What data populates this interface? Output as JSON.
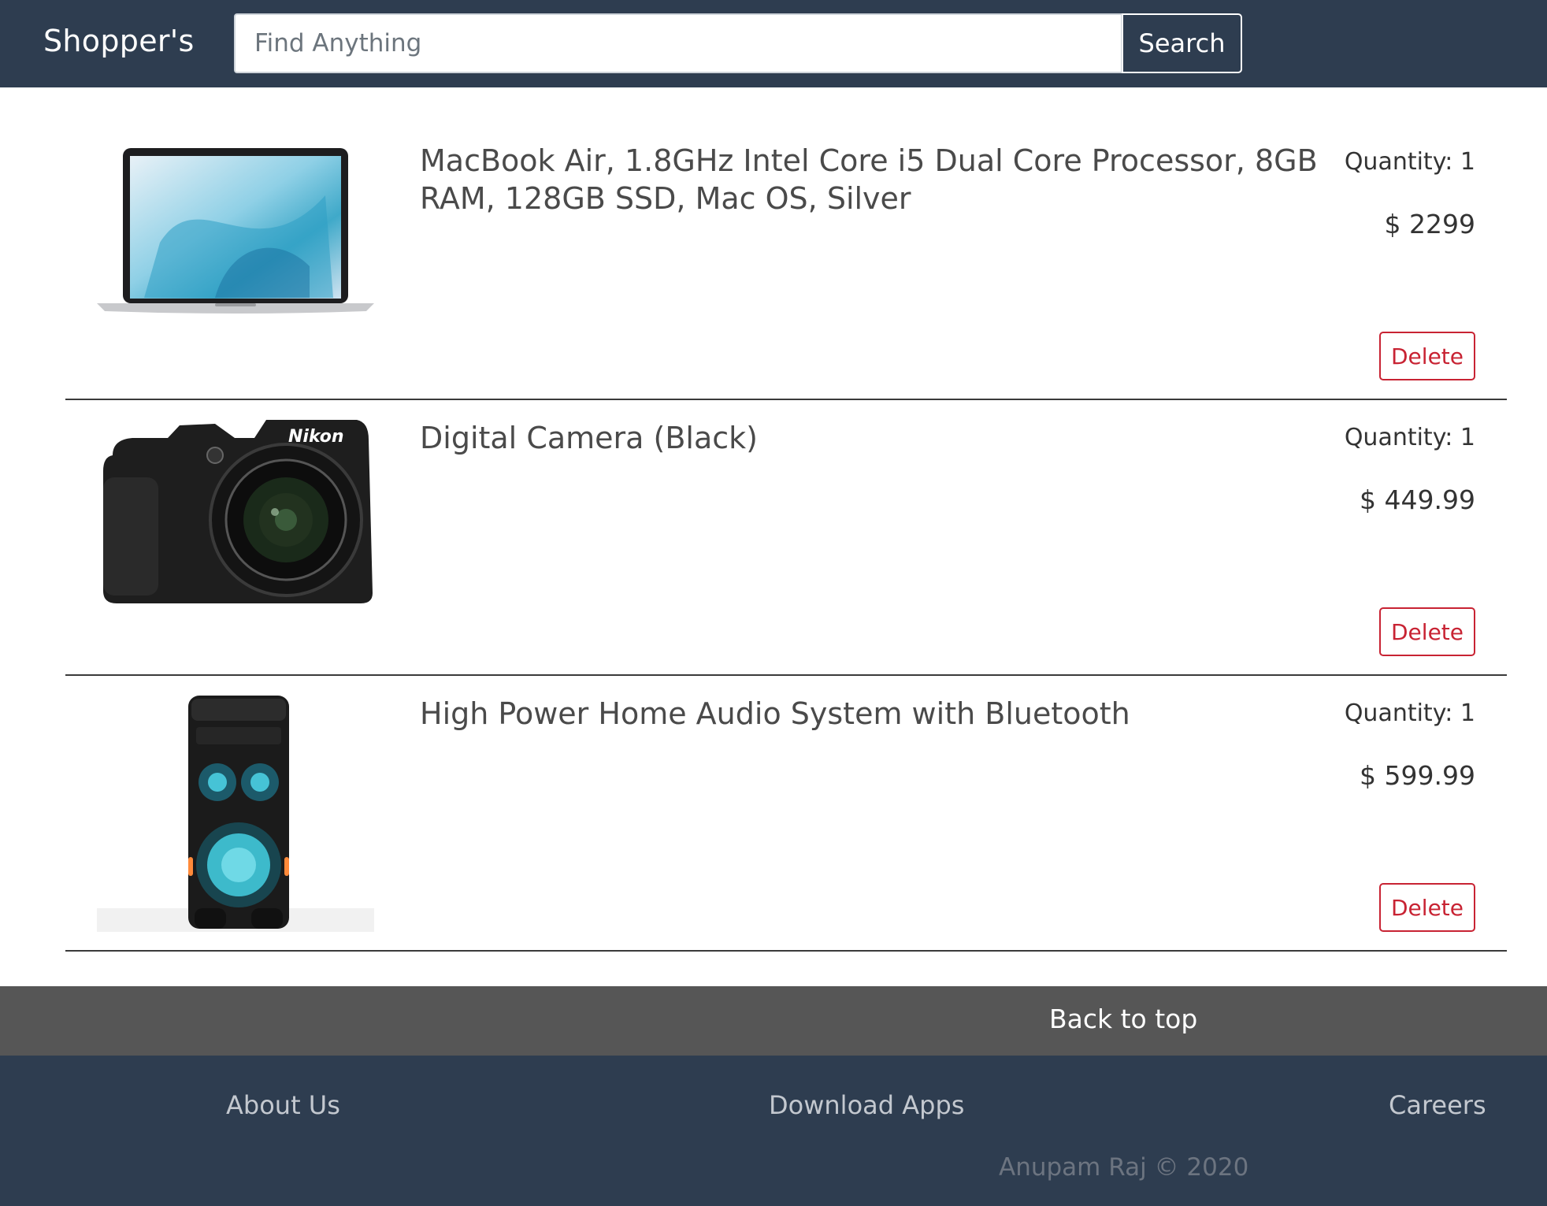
{
  "header": {
    "brand": "Shopper's",
    "search_placeholder": "Find Anything",
    "search_value": "",
    "search_button": "Search"
  },
  "cart_items": [
    {
      "title": "MacBook Air, 1.8GHz Intel Core i5 Dual Core Processor, 8GB RAM, 128GB SSD, Mac OS, Silver",
      "quantity": "Quantity: 1",
      "price": "$ 2299",
      "delete_label": "Delete",
      "image": "laptop"
    },
    {
      "title": "Digital Camera (Black)",
      "quantity": "Quantity: 1",
      "price": "$ 449.99",
      "delete_label": "Delete",
      "image": "camera",
      "image_text": "Nikon"
    },
    {
      "title": "High Power Home Audio System with Bluetooth",
      "quantity": "Quantity: 1",
      "price": "$ 599.99",
      "delete_label": "Delete",
      "image": "speaker"
    }
  ],
  "back_to_top": "Back to top",
  "footer": {
    "links": [
      "About Us",
      "Download Apps",
      "Careers"
    ],
    "copyright": "Anupam Raj © 2020"
  },
  "colors": {
    "navbar": "#2e3d50",
    "back_to_top_bar": "#565656",
    "delete": "#c82333"
  }
}
